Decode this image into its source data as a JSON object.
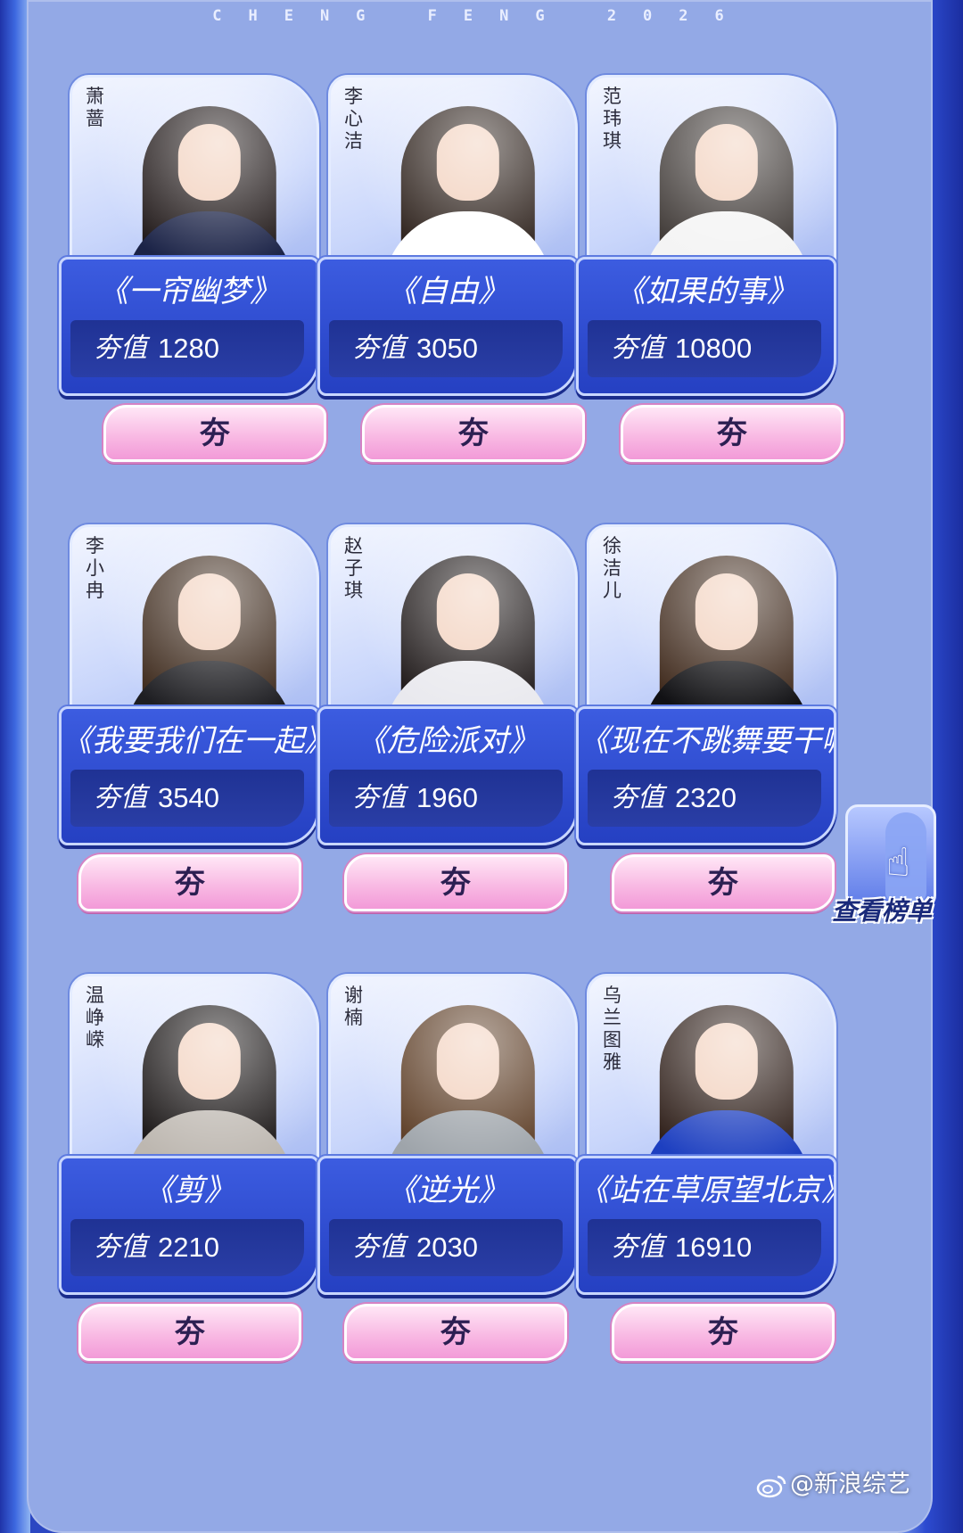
{
  "header": {
    "text": "CHENG FENG 2026"
  },
  "value_label": "夯值",
  "praise_label": "夯",
  "contestants": [
    {
      "name": "萧蔷",
      "song": "《一帘幽梦》",
      "value": "1280",
      "hair": "#1c1414",
      "outfit": "#1b2347"
    },
    {
      "name": "李心洁",
      "song": "《自由》",
      "value": "3050",
      "hair": "#2a1e18",
      "outfit": "#ffffff"
    },
    {
      "name": "范玮琪",
      "song": "《如果的事》",
      "value": "10800",
      "hair": "#3b3532",
      "outfit": "#f4f4f4"
    },
    {
      "name": "李小冉",
      "song": "《我要我们在一起》",
      "value": "3540",
      "hair": "#3a2618",
      "outfit": "#1e1e22"
    },
    {
      "name": "赵子琪",
      "song": "《危险派对》",
      "value": "1960",
      "hair": "#1a1414",
      "outfit": "#e9e9ee"
    },
    {
      "name": "徐洁儿",
      "song": "《现在不跳舞要干嘛》",
      "value": "2320",
      "hair": "#3c2618",
      "outfit": "#111114"
    },
    {
      "name": "温峥嵘",
      "song": "《剪》",
      "value": "2210",
      "hair": "#141010",
      "outfit": "#bdb7b0"
    },
    {
      "name": "谢楠",
      "song": "《逆光》",
      "value": "2030",
      "hair": "#5a3a22",
      "outfit": "#9ea4aa"
    },
    {
      "name": "乌兰图雅",
      "song": "《站在草原望北京》",
      "value": "16910",
      "hair": "#2a1a14",
      "outfit": "#1d3fc0"
    }
  ],
  "rank_button": {
    "label": "查看榜单",
    "icon": "pointing-hand-icon"
  },
  "watermark": {
    "text": "@新浪综艺",
    "icon": "weibo-icon"
  }
}
